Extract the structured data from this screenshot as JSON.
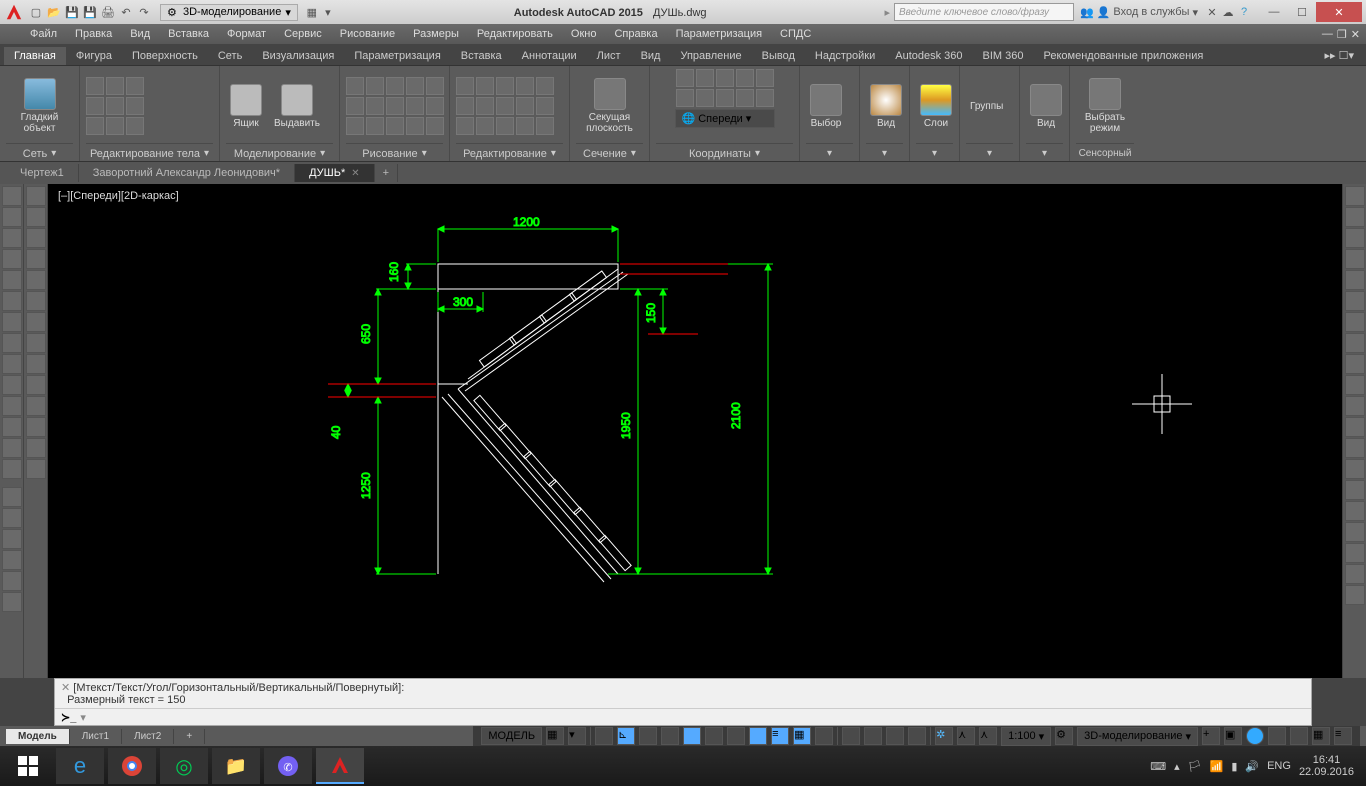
{
  "title": {
    "app": "Autodesk AutoCAD 2015",
    "file": "ДУШь.dwg"
  },
  "workspace": "3D-моделирование",
  "search_placeholder": "Введите ключевое слово/фразу",
  "signin": "Вход в службы",
  "menubar": [
    "Файл",
    "Правка",
    "Вид",
    "Вставка",
    "Формат",
    "Сервис",
    "Рисование",
    "Размеры",
    "Редактировать",
    "Окно",
    "Справка",
    "Параметризация",
    "СПДС"
  ],
  "ribbon_tabs": [
    "Главная",
    "Фигура",
    "Поверхность",
    "Сеть",
    "Визуализация",
    "Параметризация",
    "Вставка",
    "Аннотации",
    "Лист",
    "Вид",
    "Управление",
    "Вывод",
    "Надстройки",
    "Autodesk 360",
    "BIM 360",
    "Рекомендованные приложения"
  ],
  "ribbon_panels": {
    "p1": {
      "label": "Гладкий объект",
      "title": "Сеть"
    },
    "p2": {
      "title": "Редактирование тела"
    },
    "p3": {
      "btn1": "Ящик",
      "btn2": "Выдавить",
      "title": "Моделирование"
    },
    "p4": {
      "title": "Рисование"
    },
    "p5": {
      "title": "Редактирование"
    },
    "p6": {
      "label": "Секущая плоскость",
      "title": "Сечение"
    },
    "p7": {
      "btn": "Спереди",
      "title": "Координаты"
    },
    "p8": {
      "label": "Выбор"
    },
    "p9": {
      "label": "Вид"
    },
    "p10": {
      "label": "Слои"
    },
    "p11": {
      "label": "Группы"
    },
    "p12": {
      "label": "Вид"
    },
    "p13": {
      "label": "Выбрать режим",
      "title": "Сенсорный"
    }
  },
  "doc_tabs": [
    {
      "name": "Чертеж1",
      "active": false
    },
    {
      "name": "Заворотний Александр Леонидович*",
      "active": false
    },
    {
      "name": "ДУШЬ*",
      "active": true
    }
  ],
  "view_label": "[–][Спереди][2D-каркас]",
  "dims": {
    "d1": "1200",
    "d2": "160",
    "d3": "300",
    "d4": "150",
    "d5": "650",
    "d6": "40",
    "d7": "1950",
    "d8": "1250",
    "d9": "2100"
  },
  "cmd_hist_line1": "[Мтекст/Текст/Угол/Горизонтальный/Вертикальный/Повернутый]:",
  "cmd_hist_line2": "Размерный текст = 150",
  "model_tabs": [
    "Модель",
    "Лист1",
    "Лист2"
  ],
  "status": {
    "model": "МОДЕЛЬ",
    "scale": "1:100",
    "ws": "3D-моделирование"
  },
  "tray": {
    "lang": "ENG",
    "time": "16:41",
    "date": "22.09.2016"
  }
}
